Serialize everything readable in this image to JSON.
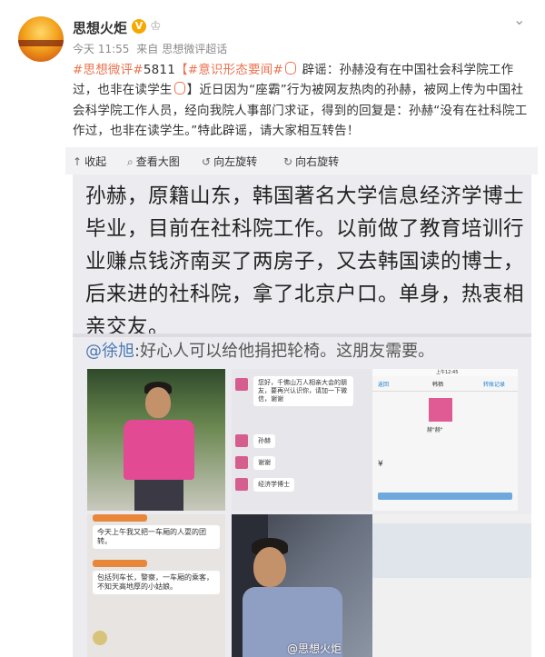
{
  "post": {
    "author": "思想火炬",
    "verified_mark": "V",
    "time": "今天 11:55",
    "source_prefix": "来自",
    "source": "思想微评超话",
    "tag_weiping": "#思想微评#",
    "number": "5811",
    "tag_yishi": "【#意识形态要闻#",
    "headline": "辟谣：孙赫没有在中国社会科学院工作过，也非在读学生",
    "bracket_close": "】",
    "body": "近日因为“座霸”行为被网友热肉的孙赫，被网上传为中国社会科学院工作人员，经向我院人事部门求证，得到的回复是：孙赫“没有在社科院工作过，也非在读学生。”特此辟谣，请大家相互转告！"
  },
  "toolbar": {
    "collapse": "收起",
    "view_large": "查看大图",
    "rotate_left": "向左旋转",
    "rotate_right": "向右旋转"
  },
  "image": {
    "big_text": "孙赫，原籍山东，韩国著名大学信息经济学博士毕业，目前在社科院工作。以前做了教育培训行业赚点钱济南买了两房子，又去韩国读的博士，后来进的社科院，拿了北京户口。单身，热衷相亲交友。",
    "mention_handle": "@徐旭",
    "mention_text": ":好心人可以给他捐把轮椅。这朋友需要。",
    "chat1_msg": "您好，千佛山万人相亲大会的朋友，要再兴认识你，请加一下微信，谢谢",
    "chat1_r1": "孙赫",
    "chat1_r2": "谢谢",
    "chat1_r3": "经济学博士",
    "chat2_msg1": "今天上午我又把一车厢的人耍的团转。",
    "chat2_msg2": "包括列车长，警察，一车厢的乘客，不知天高地厚的小姑娘。",
    "phone_time": "上午12:45",
    "phone_back": "返回",
    "phone_title": "韩栖",
    "phone_action": "转账记录",
    "phone_name": "赫\"赫\"",
    "watermark": "@思想火炬"
  }
}
